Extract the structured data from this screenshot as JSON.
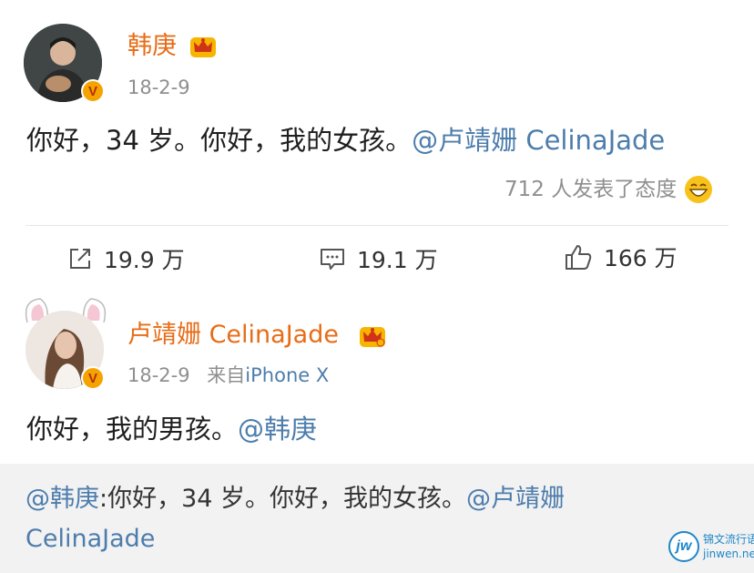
{
  "post1": {
    "username": "韩庚",
    "date": "18-2-9",
    "text": "你好，34 岁。你好，我的女孩。",
    "mention": "@卢靖姗 CelinaJade",
    "reactions": "712 人发表了态度",
    "actions": {
      "repost": "19.9 万",
      "comment": "19.1 万",
      "like": "166 万"
    }
  },
  "post2": {
    "username": "卢靖姗 CelinaJade",
    "date": "18-2-9",
    "source_prefix": "来自",
    "source": "iPhone X",
    "text": "你好，我的男孩。",
    "mention": "@韩庚",
    "quote": {
      "mention": "@韩庚",
      "text": ":你好，34 岁。你好，我的女孩。",
      "mention2": "@卢靖姗",
      "line2": "CelinaJade"
    }
  },
  "watermark": {
    "logo": "jw",
    "line1": "锦文流行语",
    "line2": "jinwen.net"
  },
  "colors": {
    "username": "#e86c16",
    "link": "#4d7dac",
    "meta": "#8f8f8f",
    "quote_bg": "#f2f2f2"
  }
}
